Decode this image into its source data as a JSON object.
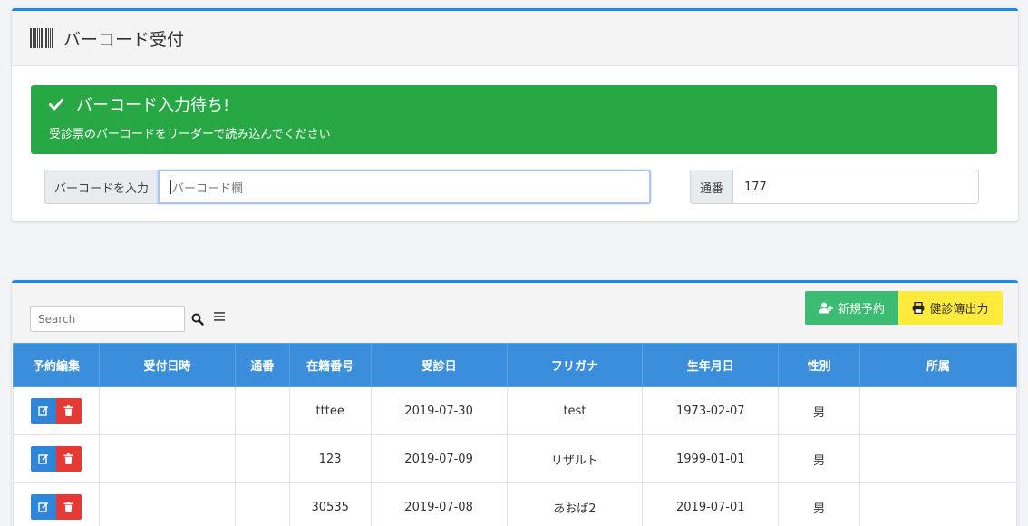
{
  "header": {
    "title": "バーコード受付",
    "icon": "barcode-icon"
  },
  "alert": {
    "title": "バーコード入力待ち!",
    "message": "受診票のバーコードをリーダーで読み込んでください",
    "color": "#28a745",
    "icon": "check-icon"
  },
  "barcode_input": {
    "label": "バーコードを入力",
    "placeholder": "バーコード欄",
    "value": ""
  },
  "serial": {
    "label": "通番",
    "value": "177"
  },
  "toolbar": {
    "search_placeholder": "Search",
    "new_reservation_label": "新規予約",
    "print_label": "健診簿出力"
  },
  "table": {
    "columns": [
      "予約編集",
      "受付日時",
      "通番",
      "在籍番号",
      "受診日",
      "フリガナ",
      "生年月日",
      "性別",
      "所属"
    ],
    "rows": [
      {
        "received_at": "",
        "serial": "",
        "enrollment_no": "tttee",
        "exam_date": "2019-07-30",
        "furigana": "test",
        "birthdate": "1973-02-07",
        "sex": "男",
        "affiliation": ""
      },
      {
        "received_at": "",
        "serial": "",
        "enrollment_no": "123",
        "exam_date": "2019-07-09",
        "furigana": "リザルト",
        "birthdate": "1999-01-01",
        "sex": "男",
        "affiliation": ""
      },
      {
        "received_at": "",
        "serial": "",
        "enrollment_no": "30535",
        "exam_date": "2019-07-08",
        "furigana": "あおば2",
        "birthdate": "2019-07-01",
        "sex": "男",
        "affiliation": ""
      }
    ]
  },
  "colors": {
    "accent": "#1e88e5",
    "table_header": "#3b8edb",
    "new_button": "#3cbc73",
    "print_button": "#ffeb3b",
    "edit": "#2f86d8",
    "delete": "#e53935"
  }
}
